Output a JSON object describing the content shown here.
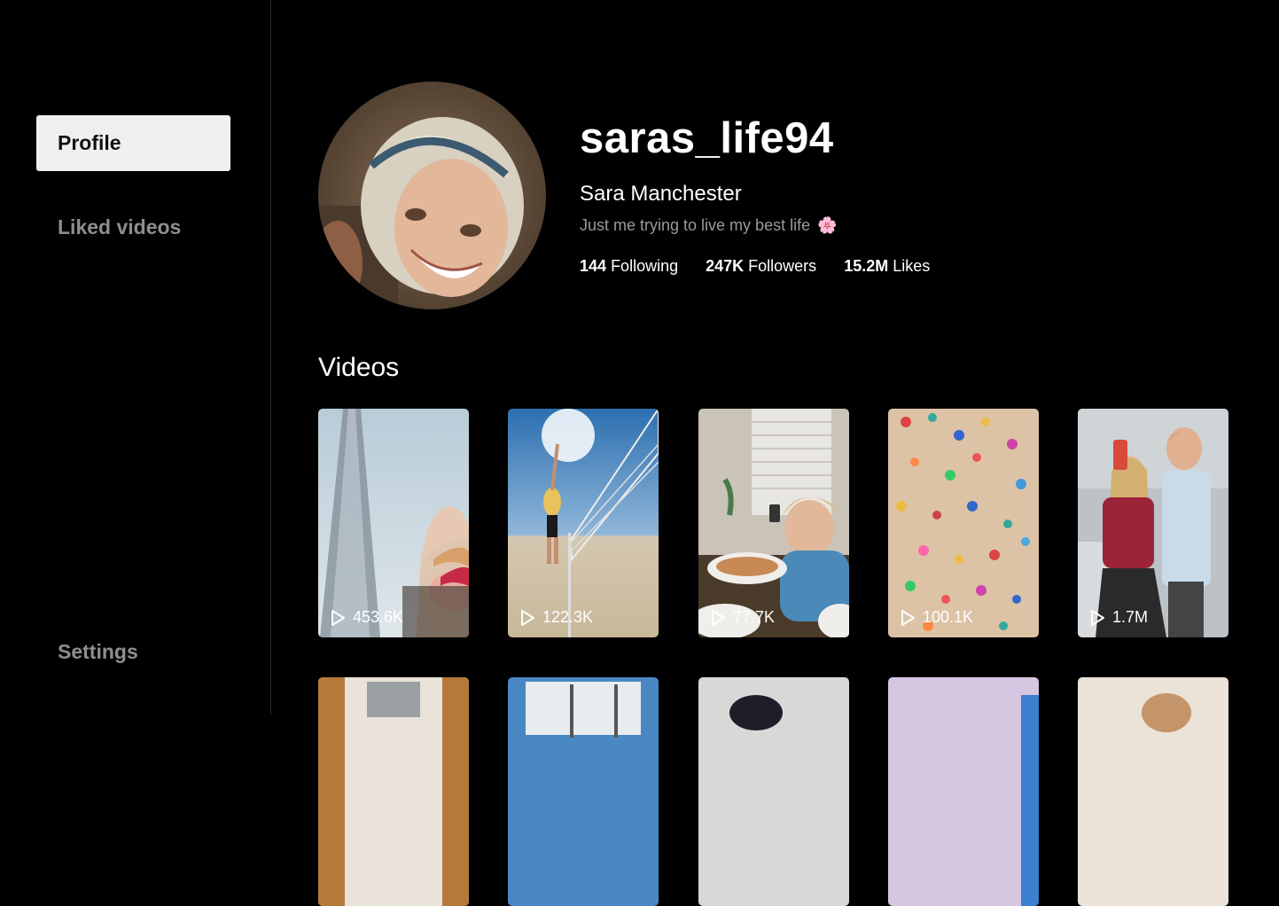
{
  "sidebar": {
    "items": [
      {
        "label": "Profile",
        "active": true
      },
      {
        "label": "Liked videos",
        "active": false
      }
    ],
    "settings_label": "Settings"
  },
  "profile": {
    "username": "saras_life94",
    "full_name": "Sara Manchester",
    "bio": "Just me trying to live my best life",
    "bio_emoji": "🌸",
    "stats": [
      {
        "value": "144",
        "label": "Following"
      },
      {
        "value": "247K",
        "label": "Followers"
      },
      {
        "value": "15.2M",
        "label": "Likes"
      }
    ]
  },
  "videos": {
    "title": "Videos",
    "items": [
      {
        "views": "453.6K",
        "icon": "play-icon"
      },
      {
        "views": "122.3K",
        "icon": "play-icon"
      },
      {
        "views": "77.7K",
        "icon": "play-icon"
      },
      {
        "views": "100.1K",
        "icon": "play-icon"
      },
      {
        "views": "1.7M",
        "icon": "play-icon"
      }
    ]
  },
  "colors": {
    "background": "#000000",
    "active_nav_bg": "#efefef",
    "muted_text": "#8e8e8e"
  }
}
